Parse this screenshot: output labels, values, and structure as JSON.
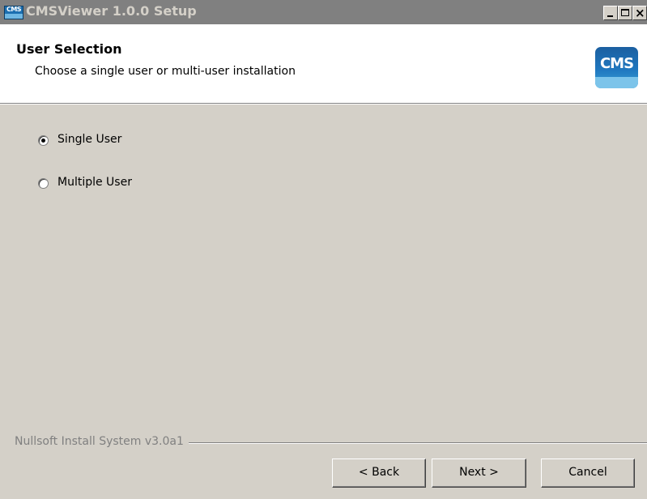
{
  "window": {
    "title": "CMSViewer 1.0.0 Setup",
    "icon_text": "CMS",
    "controls": {
      "minimize_icon": "minimize-icon",
      "maximize_icon": "maximize-icon",
      "close_glyph": "×"
    }
  },
  "header": {
    "title": "User Selection",
    "subtitle": "Choose a single user or multi-user installation",
    "logo_text": "CMS"
  },
  "options": [
    {
      "label": "Single User",
      "selected": true
    },
    {
      "label": "Multiple User",
      "selected": false
    }
  ],
  "footer": {
    "branding": "Nullsoft Install System v3.0a1",
    "buttons": {
      "back": "< Back",
      "next": "Next >",
      "cancel": "Cancel"
    }
  },
  "colors": {
    "dialog_bg": "#d4d0c8",
    "titlebar_inactive": "#808080",
    "header_bg": "#ffffff",
    "logo_blue": "#1f77bf"
  }
}
